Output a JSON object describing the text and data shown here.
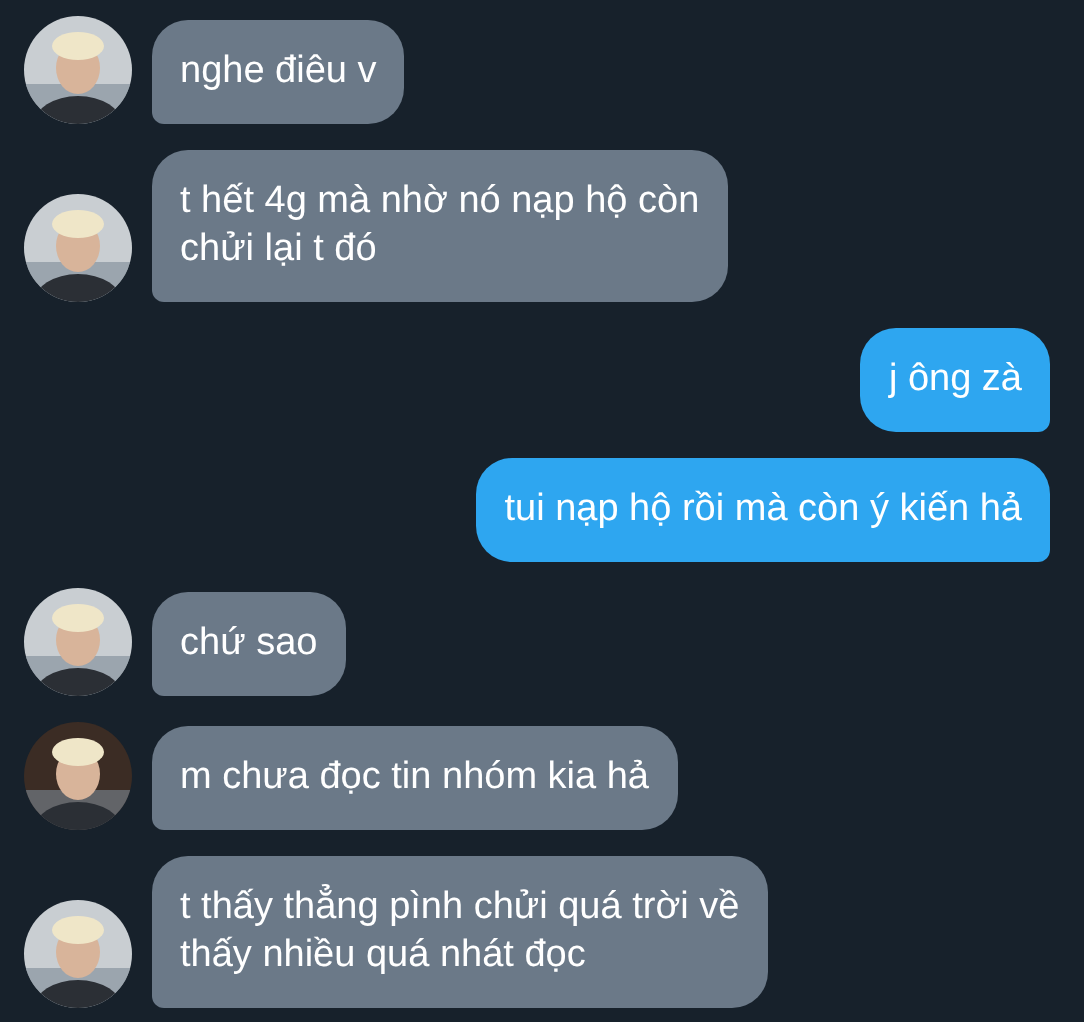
{
  "messages": [
    {
      "kind": "incoming",
      "text": "nghe điêu v"
    },
    {
      "kind": "incoming",
      "text": "t hết 4g mà nhờ nó nạp hộ còn\nchửi lại t đó"
    },
    {
      "kind": "outgoing",
      "text": "j ông zà"
    },
    {
      "kind": "outgoing",
      "text": "tui nạp hộ rồi mà còn ý kiến hả"
    },
    {
      "kind": "incoming",
      "text": "chứ sao"
    },
    {
      "kind": "incoming",
      "text": "m chưa đọc tin nhóm kia hả"
    },
    {
      "kind": "incoming",
      "text": "t thấy thẳng pình chửi quá trời về\nthấy nhiều quá nhát đọc"
    }
  ]
}
